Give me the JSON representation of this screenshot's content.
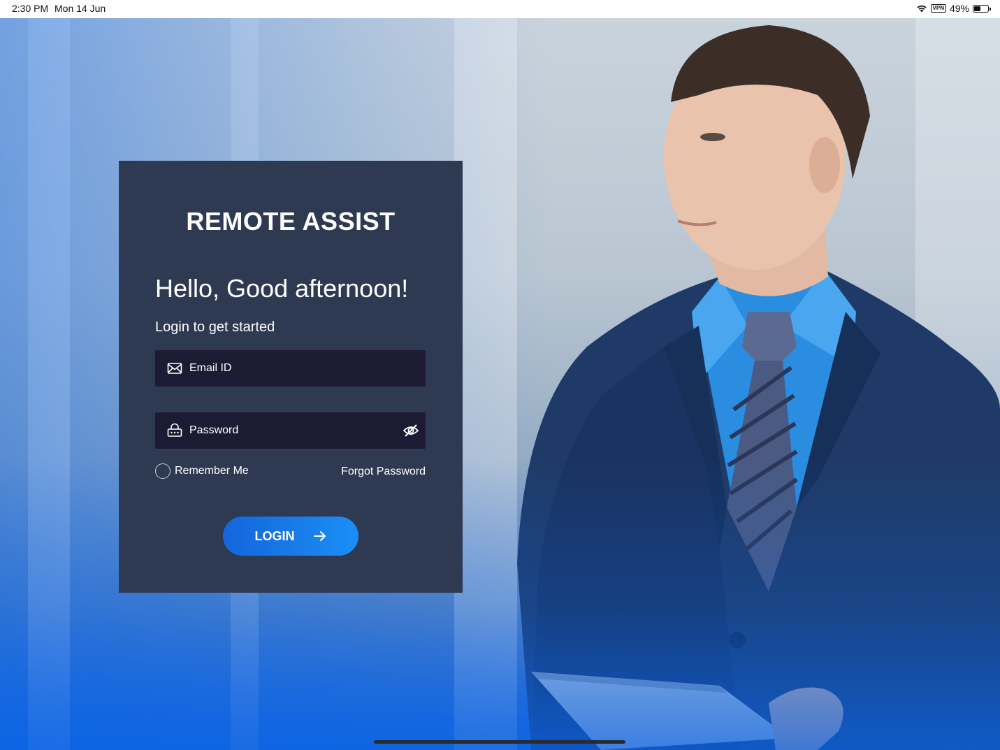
{
  "status_bar": {
    "time": "2:30 PM",
    "date": "Mon 14 Jun",
    "vpn": "VPN",
    "battery": "49%",
    "battery_level": 0.49,
    "icons": [
      "wifi-icon",
      "vpn-icon",
      "battery-icon"
    ]
  },
  "login": {
    "brand": "REMOTE ASSIST",
    "greeting": "Hello, Good afternoon!",
    "subtitle": "Login to get started",
    "email_placeholder": "Email ID",
    "email_value": "",
    "password_placeholder": "Password",
    "password_value": "",
    "remember_label": "Remember Me",
    "remember_checked": false,
    "forgot_label": "Forgot Password",
    "login_label": "LOGIN",
    "icons": [
      "envelope-icon",
      "lock-icon",
      "eye-slash-icon",
      "arrow-right-icon"
    ]
  },
  "colors": {
    "card_bg": "#2e3a52",
    "field_bg": "#1d1b33",
    "button_start": "#1565dc",
    "button_end": "#1a8ff5"
  }
}
